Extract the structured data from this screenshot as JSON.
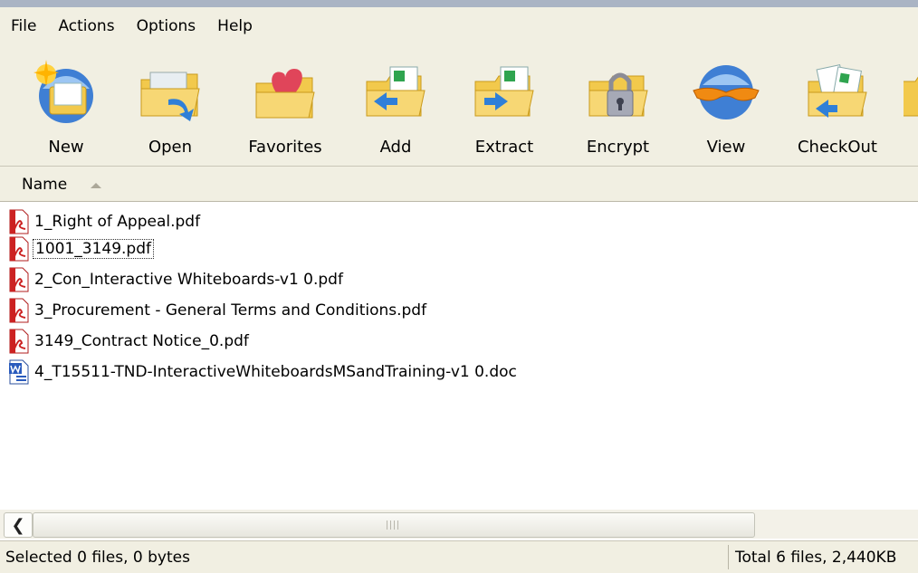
{
  "menu": [
    "File",
    "Actions",
    "Options",
    "Help"
  ],
  "toolbar": {
    "new": "New",
    "open": "Open",
    "favorites": "Favorites",
    "add": "Add",
    "extract": "Extract",
    "encrypt": "Encrypt",
    "view": "View",
    "checkout": "CheckOut"
  },
  "list": {
    "column_name": "Name",
    "files": [
      {
        "name": "1_Right of Appeal.pdf",
        "type": "pdf"
      },
      {
        "name": "1001_3149.pdf",
        "type": "pdf"
      },
      {
        "name": "2_Con_Interactive Whiteboards-v1 0.pdf",
        "type": "pdf"
      },
      {
        "name": "3_Procurement - General Terms and Conditions.pdf",
        "type": "pdf"
      },
      {
        "name": "3149_Contract Notice_0.pdf",
        "type": "pdf"
      },
      {
        "name": "4_T15511-TND-InteractiveWhiteboardsMSandTraining-v1 0.doc",
        "type": "doc"
      }
    ]
  },
  "status": {
    "selected": "Selected 0 files, 0 bytes",
    "total": "Total 6 files, 2,440KB"
  },
  "icons": {
    "pdf": "pdf-file-icon",
    "doc": "word-doc-icon"
  }
}
